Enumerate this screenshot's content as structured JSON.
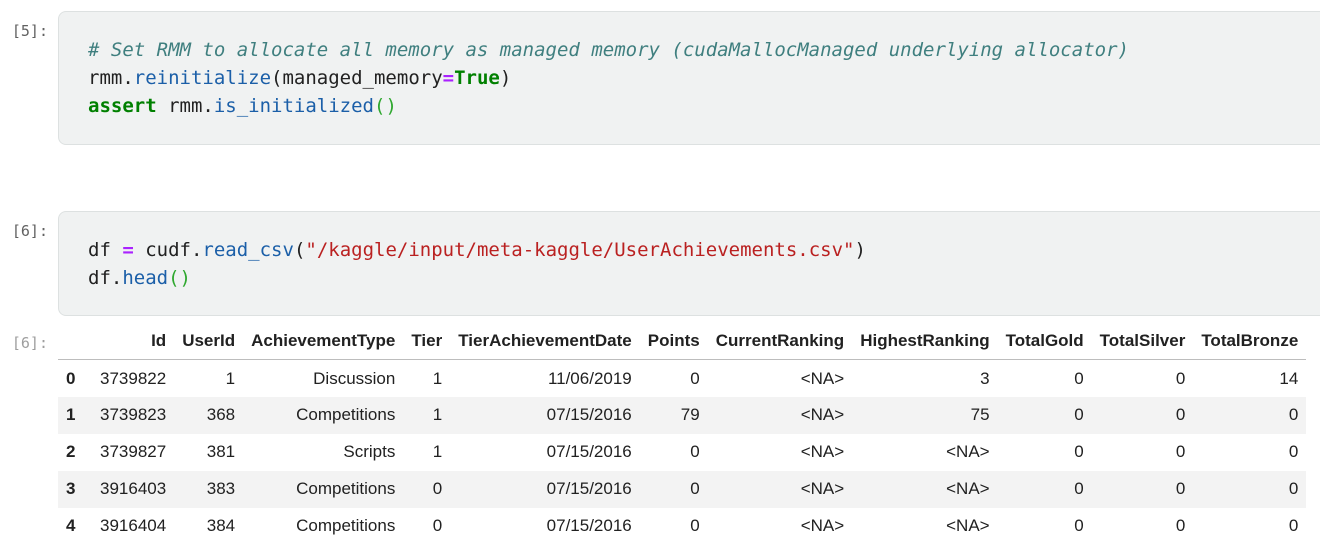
{
  "cells": [
    {
      "prompt": "[5]:",
      "code": {
        "comment": "# Set RMM to allocate all memory as managed memory (cudaMallocManaged underlying allocator)",
        "l2_obj": "rmm.",
        "l2_fn": "reinitialize",
        "l2_arg": "(managed_memory",
        "l2_op": "=",
        "l2_kw": "True",
        "l2_close": ")",
        "l3_kw": "assert",
        "l3_obj": " rmm.",
        "l3_fn": "is_initialized",
        "l3_paren": "()"
      }
    },
    {
      "prompt": "[6]:",
      "code": {
        "l1_var": "df ",
        "l1_op": "=",
        "l1_obj": " cudf.",
        "l1_fn": "read_csv",
        "l1_open": "(",
        "l1_str": "\"/kaggle/input/meta-kaggle/UserAchievements.csv\"",
        "l1_close": ")",
        "l2_obj": "df.",
        "l2_fn": "head",
        "l2_paren": "()"
      },
      "output_prompt": "[6]:"
    }
  ],
  "table": {
    "columns": [
      "",
      "Id",
      "UserId",
      "AchievementType",
      "Tier",
      "TierAchievementDate",
      "Points",
      "CurrentRanking",
      "HighestRanking",
      "TotalGold",
      "TotalSilver",
      "TotalBronze"
    ],
    "rows": [
      [
        "0",
        "3739822",
        "1",
        "Discussion",
        "1",
        "11/06/2019",
        "0",
        "<NA>",
        "3",
        "0",
        "0",
        "14"
      ],
      [
        "1",
        "3739823",
        "368",
        "Competitions",
        "1",
        "07/15/2016",
        "79",
        "<NA>",
        "75",
        "0",
        "0",
        "0"
      ],
      [
        "2",
        "3739827",
        "381",
        "Scripts",
        "1",
        "07/15/2016",
        "0",
        "<NA>",
        "<NA>",
        "0",
        "0",
        "0"
      ],
      [
        "3",
        "3916403",
        "383",
        "Competitions",
        "0",
        "07/15/2016",
        "0",
        "<NA>",
        "<NA>",
        "0",
        "0",
        "0"
      ],
      [
        "4",
        "3916404",
        "384",
        "Competitions",
        "0",
        "07/15/2016",
        "0",
        "<NA>",
        "<NA>",
        "0",
        "0",
        "0"
      ]
    ]
  }
}
